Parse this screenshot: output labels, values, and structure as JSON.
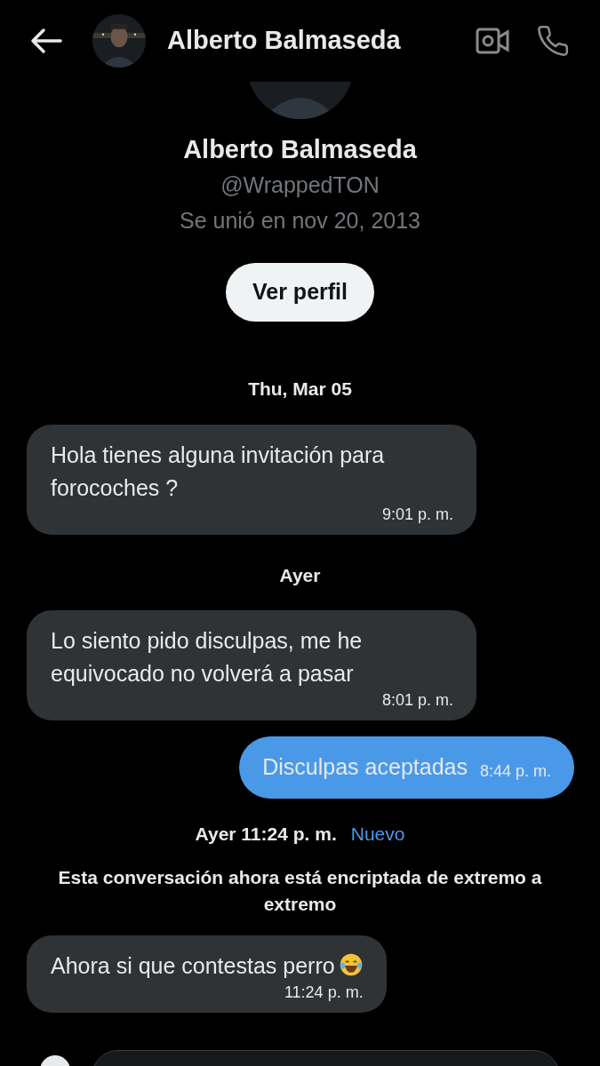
{
  "header": {
    "name": "Alberto Balmaseda"
  },
  "profile": {
    "name": "Alberto Balmaseda",
    "handle": "@WrappedTON",
    "joined": "Se unió en nov 20, 2013",
    "button": "Ver perfil"
  },
  "items": [
    {
      "kind": "date",
      "text": "Thu, Mar 05"
    },
    {
      "kind": "received",
      "text": "Hola tienes alguna invitación para forocoches ?",
      "time": "9:01 p. m."
    },
    {
      "kind": "date",
      "text": "Ayer"
    },
    {
      "kind": "received",
      "text": "Lo siento pido disculpas, me he equivocado no volverá a pasar",
      "time": "8:01 p. m."
    },
    {
      "kind": "sent",
      "text": "Disculpas aceptadas",
      "time": "8:44 p. m."
    },
    {
      "kind": "new",
      "text": "Ayer 11:24 p. m.",
      "badge": "Nuevo"
    },
    {
      "kind": "notice",
      "text": "Esta conversación ahora está encriptada de extremo a extremo"
    },
    {
      "kind": "received",
      "text": "Ahora si que contestas perro",
      "laughing_emoji": true,
      "time": "11:24 p. m."
    }
  ]
}
